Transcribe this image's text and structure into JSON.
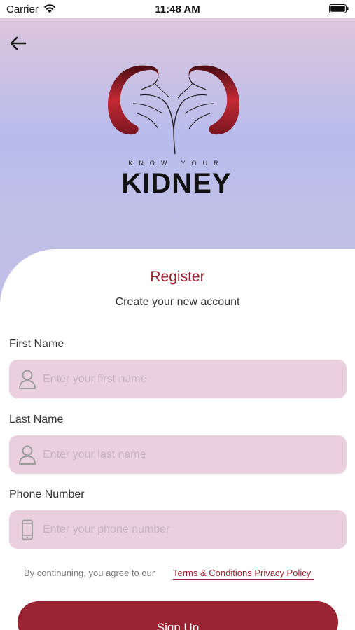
{
  "status_bar": {
    "carrier": "Carrier",
    "time": "11:48 AM",
    "wifi_icon": "wifi-icon",
    "battery_icon": "battery-icon"
  },
  "header": {
    "back_icon": "arrow-left-icon",
    "logo": {
      "tagline": "KNOW YOUR",
      "wordmark": "KIDNEY",
      "accent_color": "#9a2331"
    }
  },
  "form": {
    "title": "Register",
    "subtitle": "Create your new account",
    "fields": [
      {
        "label": "First Name",
        "placeholder": "Enter your first name",
        "icon": "user-icon"
      },
      {
        "label": "Last Name",
        "placeholder": "Enter your last name",
        "icon": "user-icon"
      },
      {
        "label": "Phone Number",
        "placeholder": "Enter your phone number",
        "icon": "phone-icon"
      }
    ],
    "terms_prefix": "By continuning, you agree to our",
    "terms_link": "Terms & Conditions Privacy Policy",
    "submit_label": "Sign Up"
  },
  "colors": {
    "primary": "#992331",
    "field_background": "#eacfdc",
    "hero_gradient_top": "#dcc6dc",
    "hero_gradient_mid": "#b8bcec"
  }
}
